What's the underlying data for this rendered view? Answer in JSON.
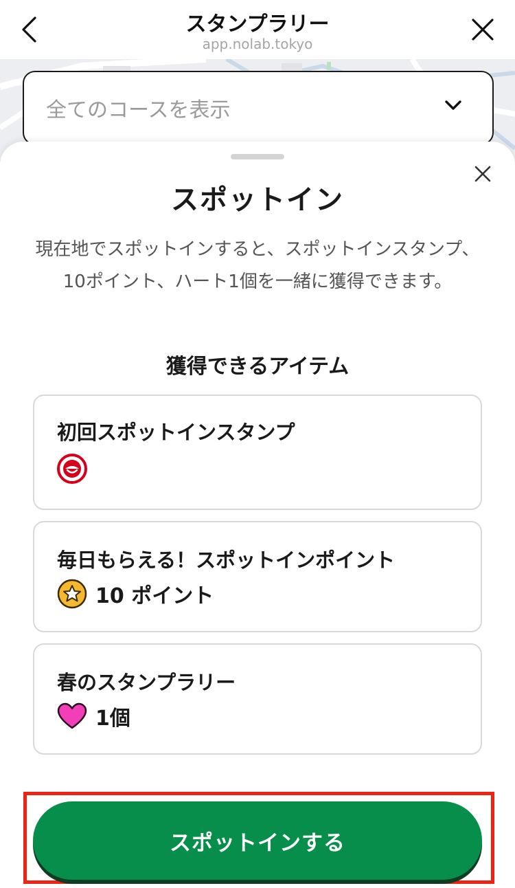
{
  "header": {
    "title": "スタンプラリー",
    "url": "app.nolab.tokyo"
  },
  "course_select": {
    "placeholder": "全てのコースを表示"
  },
  "sheet": {
    "title": "スポットイン",
    "description": "現在地でスポットインすると、スポットインスタンプ、10ポイント、ハート1個を一緒に獲得できます。",
    "items_heading": "獲得できるアイテム",
    "items": [
      {
        "title": "初回スポットインスタンプ",
        "reward_icon": "stamp-icon",
        "reward_text": ""
      },
      {
        "title": "毎日もらえる！スポットインポイント",
        "reward_icon": "star-coin-icon",
        "reward_text": "10 ポイント"
      },
      {
        "title": "春のスタンプラリー",
        "reward_icon": "heart-icon",
        "reward_text": "1個"
      }
    ],
    "action_label": "スポットインする"
  },
  "colors": {
    "primary": "#068e4a",
    "highlight_frame": "#ee2412",
    "stamp_red": "#d6001c",
    "coin_yellow": "#f5b82e",
    "heart_pink": "#f23fb8"
  }
}
